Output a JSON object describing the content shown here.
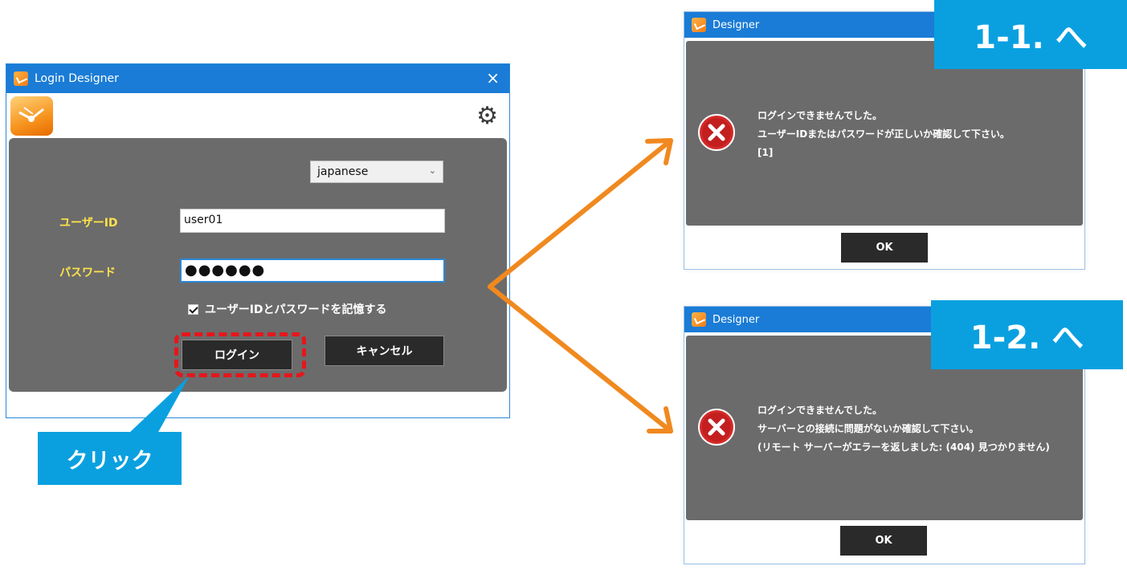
{
  "login_window": {
    "title": "Login Designer",
    "close_glyph": "×",
    "settings_icon": "gear-icon",
    "language_select": {
      "value": "japanese"
    },
    "user_id_label": "ユーザーID",
    "user_id_value": "user01",
    "password_label": "パスワード",
    "password_value": "●●●●●●",
    "remember_label": "ユーザーIDとパスワードを記憶する",
    "remember_checked": true,
    "login_button": "ログイン",
    "cancel_button": "キャンセル"
  },
  "callout": {
    "text": "クリック",
    "color": "#0aa0e0"
  },
  "dialog1": {
    "title": "Designer",
    "badge": "1-1. へ",
    "message": [
      "ログインできませんでした。",
      "ユーザーIDまたはパスワードが正しいか確認して下さい。",
      "[1]"
    ],
    "ok_button": "OK",
    "icon": "error-icon"
  },
  "dialog2": {
    "title": "Designer",
    "badge": "1-2. へ",
    "message": [
      "ログインできませんでした。",
      "サーバーとの接続に問題がないか確認して下さい。",
      "(リモート サーバーがエラーを返しました: (404) 見つかりません)"
    ],
    "ok_button": "OK",
    "icon": "error-icon"
  },
  "colors": {
    "titlebar": "#1a7cd6",
    "panel": "#6b6b6b",
    "label_yellow": "#ffe24a",
    "highlight_red": "#e6161b",
    "arrow_orange": "#f0891f",
    "badge_blue": "#0aa0e0"
  }
}
